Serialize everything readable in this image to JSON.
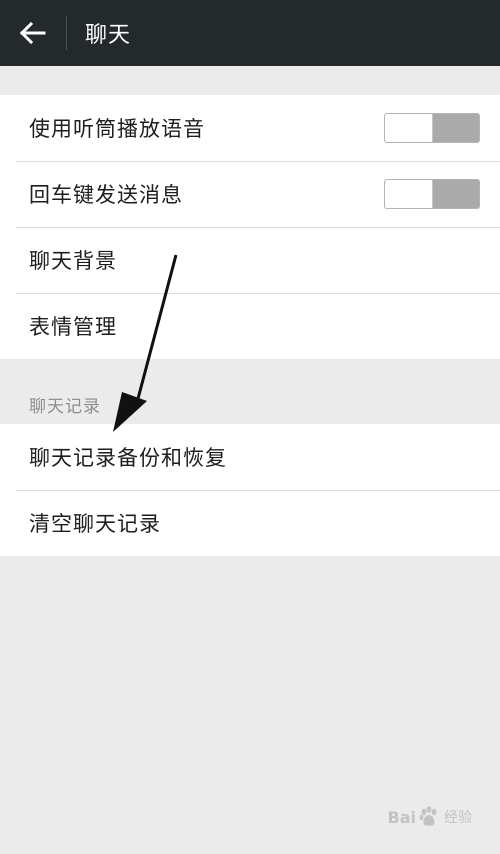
{
  "topbar": {
    "back_icon": "arrow-left-icon",
    "title": "聊天"
  },
  "settings": {
    "items": [
      {
        "label": "使用听筒播放语音",
        "toggle": false
      },
      {
        "label": "回车键发送消息",
        "toggle": false
      },
      {
        "label": "聊天背景"
      },
      {
        "label": "表情管理"
      }
    ]
  },
  "chat_records": {
    "section_title": "聊天记录",
    "items": [
      {
        "label": "聊天记录备份和恢复"
      },
      {
        "label": "清空聊天记录"
      }
    ]
  },
  "watermark": {
    "text_left": "Bai",
    "text_right": "经验"
  },
  "colors": {
    "topbar_bg": "#242a2c",
    "page_bg": "#ebebeb",
    "toggle_off_track": "#a9aaa9"
  }
}
